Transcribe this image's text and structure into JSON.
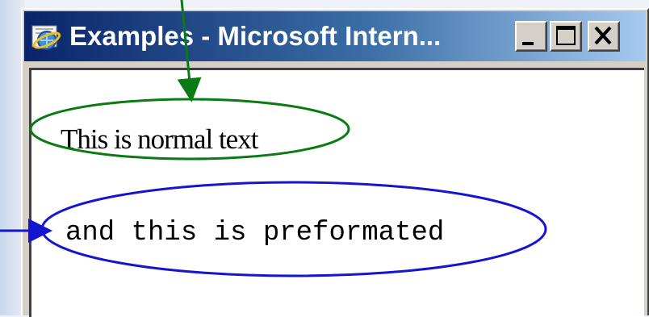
{
  "window": {
    "title": "Examples - Microsoft Intern...",
    "icon": "internet-explorer-icon",
    "caption_buttons": [
      "minimize-icon",
      "maximize-icon",
      "close-icon"
    ]
  },
  "content": {
    "normal_text": "This is normal text",
    "preformatted_text": "and this is preformated"
  },
  "annotations": {
    "normal_text_color": "#0a7a14",
    "preformatted_text_color": "#1515d0"
  },
  "colors": {
    "titlebar_start": "#0a246a",
    "titlebar_end": "#a6caf0",
    "window_face": "#d4d0c8"
  }
}
